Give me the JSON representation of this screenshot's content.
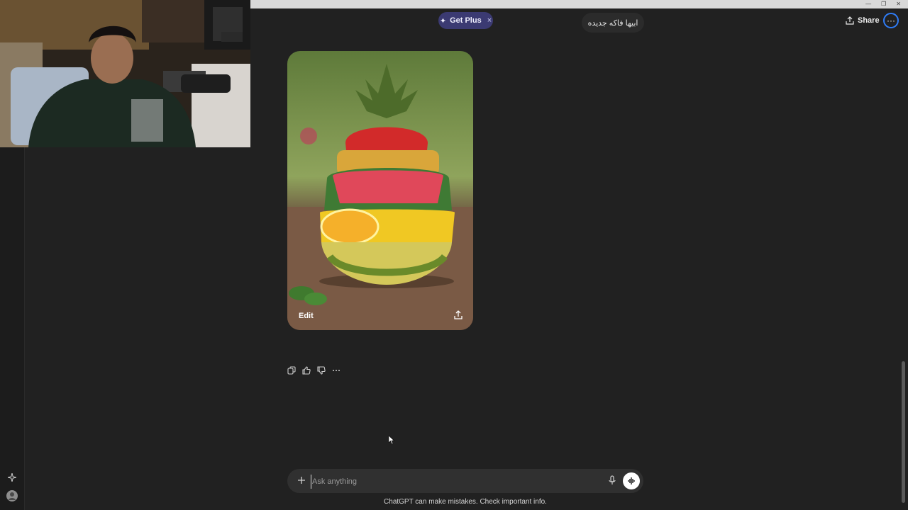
{
  "window": {
    "controls": [
      "—",
      "❐",
      "✕"
    ]
  },
  "header": {
    "get_plus_label": "Get Plus",
    "get_plus_close": "×",
    "chat_title": "ابيها فاكه جديده",
    "share_label": "Share",
    "more_label": "···"
  },
  "message": {
    "image_edit_label": "Edit"
  },
  "composer": {
    "placeholder": "Ask anything",
    "value": ""
  },
  "footer": {
    "disclaimer": "ChatGPT can make mistakes. Check important info."
  },
  "colors": {
    "background": "#212121",
    "accent_plus": "#3b3a72",
    "accent_ring": "#2f7cf6"
  },
  "icons": {
    "sidebar": [
      "sparkle-icon",
      "profile-icon"
    ],
    "actions": [
      "copy-icon",
      "thumbs-up-icon",
      "thumbs-down-icon",
      "more-icon"
    ]
  }
}
